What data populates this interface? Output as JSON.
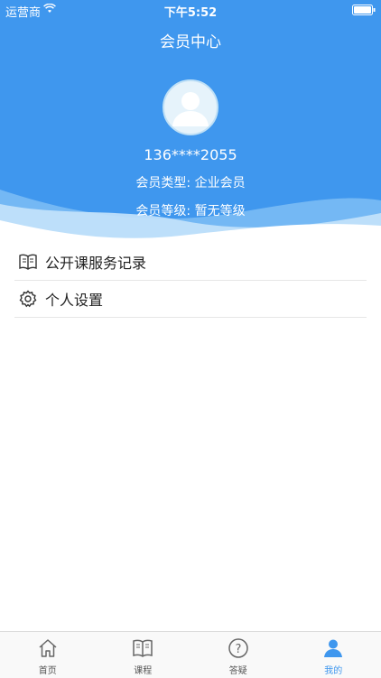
{
  "status_bar": {
    "carrier": "运营商",
    "time": "下午5:52"
  },
  "header": {
    "title": "会员中心",
    "phone": "136****2055",
    "member_type": "会员类型: 企业会员",
    "member_level": "会员等级: 暂无等级"
  },
  "menu": {
    "items": [
      {
        "label": "公开课服务记录",
        "icon": "book-icon"
      },
      {
        "label": "个人设置",
        "icon": "gear-icon"
      }
    ]
  },
  "tabbar": {
    "items": [
      {
        "label": "首页",
        "icon": "home-icon"
      },
      {
        "label": "课程",
        "icon": "book-icon"
      },
      {
        "label": "答疑",
        "icon": "question-icon"
      },
      {
        "label": "我的",
        "icon": "user-icon"
      }
    ],
    "active_index": 3
  },
  "colors": {
    "accent": "#3f97ee",
    "wave_light": "#b9dcfa"
  }
}
